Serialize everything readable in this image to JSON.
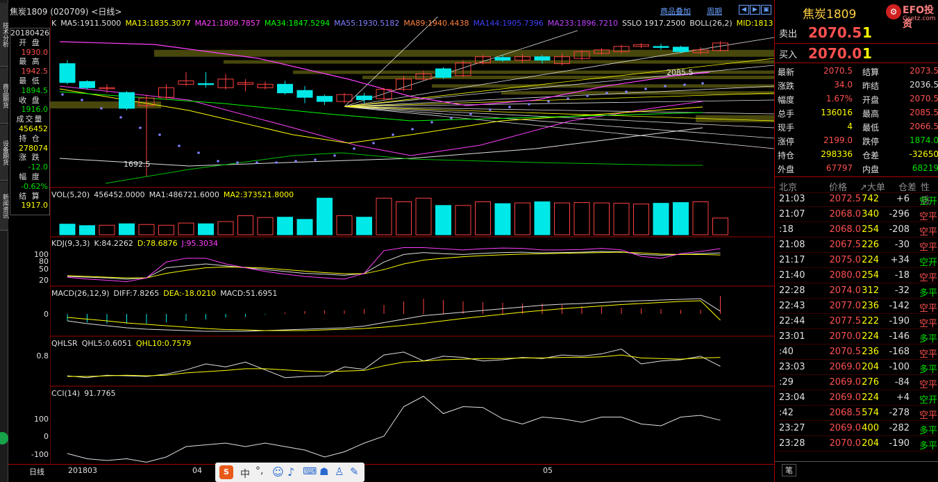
{
  "window": {
    "title": "焦炭1809 (020709) <日线>",
    "btn_overlay": "商品叠加",
    "btn_period": "周期"
  },
  "left_tabs": [
    "技术分析",
    "商品期货",
    "设备期货",
    "新闻资讯"
  ],
  "info": {
    "date": "20180426",
    "items": [
      {
        "label": "开 盘",
        "value": "1930.0",
        "color": "red"
      },
      {
        "label": "最 高",
        "value": "1942.5",
        "color": "red"
      },
      {
        "label": "最 低",
        "value": "1894.5",
        "color": "green"
      },
      {
        "label": "收 盘",
        "value": "1916.0",
        "color": "green"
      },
      {
        "label": "成交量",
        "value": "456452",
        "color": "yellow"
      },
      {
        "label": "持 仓",
        "value": "278074",
        "color": "yellow"
      },
      {
        "label": "涨 跌",
        "value": "-12.0",
        "color": "green"
      },
      {
        "label": "幅 度",
        "value": "-0.62%",
        "color": "green"
      },
      {
        "label": "结 算",
        "value": "1917.0",
        "color": "yellow"
      }
    ]
  },
  "main_indicators": [
    {
      "text": "K",
      "color": "#e0e0e0"
    },
    {
      "text": "MA5:1911.5000",
      "color": "#e0e0e0"
    },
    {
      "text": "MA13:1835.3077",
      "color": "#ffff00"
    },
    {
      "text": "MA21:1809.7857",
      "color": "#ff40ff"
    },
    {
      "text": "MA34:1847.5294",
      "color": "#00ff00"
    },
    {
      "text": "MA55:1930.5182",
      "color": "#8080ff"
    },
    {
      "text": "MA89:1940.4438",
      "color": "#ff8040"
    },
    {
      "text": "MA144:1905.7396",
      "color": "#4040ff"
    },
    {
      "text": "MA233:1896.7210",
      "color": "#c040ff"
    },
    {
      "text": "SSLO 1917.2500",
      "color": "#e0e0e0"
    },
    {
      "text": "BOLL(26,2)",
      "color": "#e0e0e0"
    },
    {
      "text": "MID:1813",
      "color": "#ffff00"
    }
  ],
  "main_annotations": {
    "high": "2085.5",
    "low": "1692.5"
  },
  "vol_indicators": [
    {
      "text": "VOL(5,20)",
      "color": "#e0e0e0"
    },
    {
      "text": "456452.0000",
      "color": "#e0e0e0"
    },
    {
      "text": "MA1:486721.6000",
      "color": "#e0e0e0"
    },
    {
      "text": "MA2:373521.8000",
      "color": "#ffff00"
    }
  ],
  "kdj_indicators": [
    {
      "text": "KDJ(9,3,3)",
      "color": "#e0e0e0"
    },
    {
      "text": "K:84.2262",
      "color": "#e0e0e0"
    },
    {
      "text": "D:78.6876",
      "color": "#ffff00"
    },
    {
      "text": "J:95.3034",
      "color": "#ff40ff"
    }
  ],
  "kdj_axis": [
    "100",
    "80",
    "50",
    "20"
  ],
  "macd_indicators": [
    {
      "text": "MACD(26,12,9)",
      "color": "#e0e0e0"
    },
    {
      "text": "DIFF:7.8265",
      "color": "#e0e0e0"
    },
    {
      "text": "DEA:-18.0210",
      "color": "#ffff00"
    },
    {
      "text": "MACD:51.6951",
      "color": "#e0e0e0"
    }
  ],
  "macd_axis": [
    "0"
  ],
  "qhlsr_indicators": [
    {
      "text": "QHLSR",
      "color": "#e0e0e0"
    },
    {
      "text": "QHL5:0.6051",
      "color": "#e0e0e0"
    },
    {
      "text": "QHL10:0.7579",
      "color": "#ffff00"
    }
  ],
  "qhlsr_axis": [
    "0.8"
  ],
  "cci_indicators": [
    {
      "text": "CCI(14)",
      "color": "#e0e0e0"
    },
    {
      "text": "91.7765",
      "color": "#e0e0e0"
    }
  ],
  "cci_axis": [
    "100",
    "0",
    "-100"
  ],
  "x_axis": {
    "period": "日线",
    "labels": [
      "201803",
      "04",
      "05"
    ]
  },
  "right": {
    "title": "焦炭1809",
    "logo_text": "EFO投资",
    "logo_sub": "Gsetz.com",
    "sell_label": "卖出",
    "sell_price": "2070.5",
    "sell_qty": "1",
    "buy_label": "买入",
    "buy_price": "2070.0",
    "buy_qty": "1",
    "quote": [
      {
        "l1": "最新",
        "v1": "2070.5",
        "c1": "red",
        "l2": "结算",
        "v2": "2073.5",
        "c2": "red"
      },
      {
        "l1": "涨跌",
        "v1": "34.0",
        "c1": "red",
        "l2": "昨结",
        "v2": "2036.5",
        "c2": "white"
      },
      {
        "l1": "幅度",
        "v1": "1.67%",
        "c1": "red",
        "l2": "开盘",
        "v2": "2070.5",
        "c2": "red"
      },
      {
        "l1": "总手",
        "v1": "136016",
        "c1": "yellow",
        "l2": "最高",
        "v2": "2085.5",
        "c2": "red"
      },
      {
        "l1": "现手",
        "v1": "4",
        "c1": "yellow",
        "l2": "最低",
        "v2": "2066.5",
        "c2": "red"
      },
      {
        "l1": "涨停",
        "v1": "2199.0",
        "c1": "red",
        "l2": "跌停",
        "v2": "1874.0",
        "c2": "green"
      },
      {
        "l1": "持仓",
        "v1": "298336",
        "c1": "yellow",
        "l2": "仓差",
        "v2": "-32650",
        "c2": "yellow"
      },
      {
        "l1": "外盘",
        "v1": "67797",
        "c1": "red",
        "l2": "内盘",
        "v2": "68219",
        "c2": "green"
      }
    ],
    "trade_header": {
      "time": "北京",
      "price": "价格",
      "vol": "↗大单",
      "oi": "仓差",
      "type": "性质"
    },
    "trades": [
      {
        "time": "21:03",
        "price": "2072.5",
        "pc": "red",
        "vol": "742",
        "oi": "+6",
        "type": "空开",
        "tc": "green"
      },
      {
        "time": "21:07",
        "price": "2068.0",
        "pc": "red",
        "vol": "340",
        "oi": "-296",
        "type": "空平",
        "tc": "red"
      },
      {
        "time": ":18",
        "price": "2068.0",
        "pc": "red",
        "vol": "254",
        "oi": "-208",
        "type": "空平",
        "tc": "red"
      },
      {
        "time": "21:08",
        "price": "2067.5",
        "pc": "red",
        "vol": "226",
        "oi": "-30",
        "type": "空平",
        "tc": "red"
      },
      {
        "time": "21:17",
        "price": "2075.0",
        "pc": "red",
        "vol": "224",
        "oi": "+34",
        "type": "空开",
        "tc": "green"
      },
      {
        "time": "21:40",
        "price": "2080.0",
        "pc": "red",
        "vol": "254",
        "oi": "-18",
        "type": "空平",
        "tc": "red"
      },
      {
        "time": "22:28",
        "price": "2074.0",
        "pc": "red",
        "vol": "312",
        "oi": "-32",
        "type": "多平",
        "tc": "green"
      },
      {
        "time": "22:43",
        "price": "2077.0",
        "pc": "red",
        "vol": "236",
        "oi": "-142",
        "type": "空平",
        "tc": "red"
      },
      {
        "time": "22:44",
        "price": "2077.5",
        "pc": "red",
        "vol": "222",
        "oi": "-190",
        "type": "空平",
        "tc": "red"
      },
      {
        "time": "23:01",
        "price": "2070.0",
        "pc": "red",
        "vol": "224",
        "oi": "-146",
        "type": "多平",
        "tc": "green"
      },
      {
        "time": ":40",
        "price": "2070.5",
        "pc": "red",
        "vol": "236",
        "oi": "-168",
        "type": "空平",
        "tc": "red"
      },
      {
        "time": "23:03",
        "price": "2069.0",
        "pc": "red",
        "vol": "204",
        "oi": "-100",
        "type": "多平",
        "tc": "green"
      },
      {
        "time": ":29",
        "price": "2069.0",
        "pc": "red",
        "vol": "276",
        "oi": "-84",
        "type": "空平",
        "tc": "red"
      },
      {
        "time": "23:04",
        "price": "2069.0",
        "pc": "red",
        "vol": "224",
        "oi": "+4",
        "type": "空开",
        "tc": "green"
      },
      {
        "time": ":42",
        "price": "2068.5",
        "pc": "red",
        "vol": "574",
        "oi": "-278",
        "type": "空平",
        "tc": "red"
      },
      {
        "time": "23:27",
        "price": "2069.0",
        "pc": "red",
        "vol": "400",
        "oi": "-282",
        "type": "多平",
        "tc": "green"
      },
      {
        "time": "23:28",
        "price": "2070.0",
        "pc": "red",
        "vol": "204",
        "oi": "-190",
        "type": "多平",
        "tc": "green"
      }
    ],
    "bottom_tab": "笔"
  },
  "chart_data": {
    "type": "candlestick",
    "candles": [
      {
        "o": 2020,
        "c": 1965,
        "h": 2030,
        "l": 1960
      },
      {
        "o": 1968,
        "c": 1950,
        "h": 1972,
        "l": 1945
      },
      {
        "o": 1950,
        "c": 1950,
        "h": 1960,
        "l": 1935
      },
      {
        "o": 1936,
        "c": 1890,
        "h": 1940,
        "l": 1885
      },
      {
        "o": 1898,
        "c": 1920,
        "h": 1930,
        "l": 1692.5
      },
      {
        "o": 1922,
        "c": 1950,
        "h": 1960,
        "l": 1915
      },
      {
        "o": 1960,
        "c": 1970,
        "h": 1995,
        "l": 1955
      },
      {
        "o": 1962,
        "c": 1960,
        "h": 1995,
        "l": 1950
      },
      {
        "o": 1950,
        "c": 1975,
        "h": 1990,
        "l": 1945
      },
      {
        "o": 1960,
        "c": 1965,
        "h": 1975,
        "l": 1940
      },
      {
        "o": 1950,
        "c": 1960,
        "h": 1968,
        "l": 1945
      },
      {
        "o": 1960,
        "c": 1935,
        "h": 1970,
        "l": 1930
      },
      {
        "o": 1942,
        "c": 1922,
        "h": 1955,
        "l": 1905
      },
      {
        "o": 1925,
        "c": 1910,
        "h": 1930,
        "l": 1900
      },
      {
        "o": 1910,
        "c": 1930,
        "h": 1935,
        "l": 1905
      },
      {
        "o": 1926,
        "c": 1915,
        "h": 1935,
        "l": 1905
      },
      {
        "o": 1918,
        "c": 1945,
        "h": 1950,
        "l": 1912
      },
      {
        "o": 1945,
        "c": 1975,
        "h": 1985,
        "l": 1940
      },
      {
        "o": 1975,
        "c": 1990,
        "h": 2000,
        "l": 1970
      },
      {
        "o": 2005,
        "c": 1980,
        "h": 2010,
        "l": 1975
      },
      {
        "o": 1985,
        "c": 2022,
        "h": 2030,
        "l": 1980
      },
      {
        "o": 2022,
        "c": 2040,
        "h": 2045,
        "l": 2018
      },
      {
        "o": 2038,
        "c": 2030,
        "h": 2046,
        "l": 2025
      },
      {
        "o": 2030,
        "c": 2040,
        "h": 2048,
        "l": 2022
      },
      {
        "o": 2040,
        "c": 2030,
        "h": 2045,
        "l": 2020
      },
      {
        "o": 2020,
        "c": 2040,
        "h": 2050,
        "l": 2015
      },
      {
        "o": 2035,
        "c": 2055,
        "h": 2060,
        "l": 2030
      },
      {
        "o": 2050,
        "c": 2060,
        "h": 2065,
        "l": 2045
      },
      {
        "o": 2055,
        "c": 2070,
        "h": 2075,
        "l": 2050
      },
      {
        "o": 2070,
        "c": 2075,
        "h": 2080,
        "l": 2065
      },
      {
        "o": 2070,
        "c": 2068,
        "h": 2078,
        "l": 2060
      },
      {
        "o": 2068,
        "c": 2055,
        "h": 2072,
        "l": 2050
      },
      {
        "o": 2052,
        "c": 2060,
        "h": 2068,
        "l": 2048
      },
      {
        "o": 2058,
        "c": 2080,
        "h": 2085.5,
        "l": 2055
      }
    ],
    "volumes": [
      290000,
      250000,
      260000,
      300000,
      280000,
      260000,
      320000,
      300000,
      360000,
      520000,
      470000,
      480000,
      420000,
      1000000,
      520000,
      480000,
      1000000,
      900000,
      1000000,
      800000,
      800000,
      900000,
      850000,
      870000,
      900000,
      870000,
      880000,
      870000,
      860000,
      840000,
      860000,
      880000,
      900000,
      456452
    ],
    "kdj_k": [
      22,
      20,
      18,
      15,
      18,
      45,
      50,
      55,
      50,
      45,
      40,
      35,
      30,
      28,
      25,
      30,
      60,
      80,
      85,
      82,
      80,
      83,
      85,
      86,
      84,
      85,
      86,
      88,
      87,
      80,
      78,
      80,
      82,
      84.2
    ],
    "kdj_d": [
      24,
      22,
      20,
      18,
      18,
      30,
      38,
      45,
      47,
      46,
      44,
      40,
      36,
      32,
      29,
      29,
      40,
      55,
      65,
      70,
      74,
      77,
      79,
      81,
      82,
      83,
      84,
      85,
      86,
      84,
      81,
      80,
      80,
      78.7
    ],
    "kdj_j": [
      20,
      15,
      12,
      8,
      18,
      60,
      70,
      70,
      55,
      45,
      35,
      28,
      22,
      18,
      15,
      30,
      90,
      98,
      98,
      95,
      92,
      95,
      97,
      96,
      92,
      92,
      93,
      96,
      92,
      75,
      70,
      82,
      88,
      95.3
    ],
    "macd_diff": [
      -20,
      -28,
      -34,
      -40,
      -44,
      -46,
      -48,
      -50,
      -50,
      -50,
      -48,
      -46,
      -44,
      -42,
      -40,
      -35,
      -25,
      -15,
      -5,
      0,
      5,
      10,
      15,
      20,
      25,
      28,
      30,
      33,
      36,
      38,
      40,
      42,
      44,
      7.8
    ],
    "macd_dea": [
      -10,
      -15,
      -20,
      -26,
      -30,
      -34,
      -38,
      -42,
      -45,
      -46,
      -48,
      -48,
      -48,
      -46,
      -44,
      -42,
      -38,
      -33,
      -27,
      -20,
      -13,
      -7,
      -1,
      5,
      10,
      15,
      19,
      23,
      27,
      30,
      33,
      36,
      38,
      -18
    ],
    "macd_hist": [
      -20,
      -25,
      -28,
      -28,
      -28,
      -24,
      -20,
      -16,
      -10,
      -8,
      -2,
      4,
      8,
      10,
      10,
      14,
      26,
      36,
      44,
      40,
      36,
      34,
      32,
      30,
      30,
      26,
      22,
      20,
      18,
      16,
      14,
      12,
      12,
      52
    ],
    "qhl5": [
      0.45,
      0.42,
      0.46,
      0.45,
      0.44,
      0.48,
      0.55,
      0.65,
      0.6,
      0.68,
      0.55,
      0.42,
      0.44,
      0.45,
      0.6,
      0.56,
      0.8,
      0.85,
      0.7,
      0.78,
      0.76,
      0.7,
      0.72,
      0.76,
      0.74,
      0.8,
      0.78,
      0.82,
      0.9,
      0.65,
      0.7,
      0.72,
      0.78,
      0.61
    ],
    "qhl10": [
      0.44,
      0.44,
      0.45,
      0.46,
      0.45,
      0.46,
      0.5,
      0.52,
      0.54,
      0.57,
      0.57,
      0.55,
      0.53,
      0.52,
      0.53,
      0.54,
      0.62,
      0.68,
      0.7,
      0.72,
      0.73,
      0.74,
      0.74,
      0.75,
      0.75,
      0.76,
      0.76,
      0.77,
      0.8,
      0.75,
      0.74,
      0.73,
      0.75,
      0.76
    ],
    "cci": [
      -100,
      -130,
      -140,
      -130,
      -150,
      -120,
      -60,
      -50,
      -40,
      -60,
      -40,
      -60,
      -80,
      -120,
      -90,
      -40,
      0,
      170,
      230,
      130,
      170,
      165,
      100,
      70,
      110,
      100,
      80,
      110,
      110,
      70,
      60,
      110,
      120,
      91.8
    ]
  }
}
